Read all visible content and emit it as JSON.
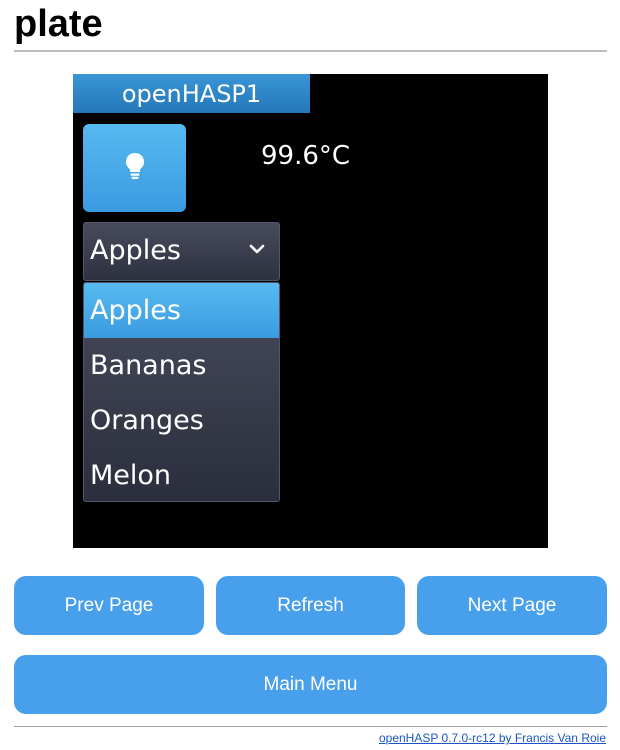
{
  "page": {
    "title": "plate"
  },
  "screen": {
    "title": "openHASP1",
    "temperature": "99.6°C",
    "light_button_icon": "lightbulb-icon",
    "dropdown": {
      "selected": "Apples",
      "options": [
        "Apples",
        "Bananas",
        "Oranges",
        "Melon"
      ]
    }
  },
  "nav": {
    "prev_label": "Prev Page",
    "refresh_label": "Refresh",
    "next_label": "Next Page",
    "main_label": "Main Menu"
  },
  "footer": {
    "link_text": "openHASP 0.7.0-rc12 by Francis Van Roie"
  },
  "colors": {
    "button_blue": "#48a0ec",
    "screen_title_blue": "#2f86c8",
    "screen_background": "#000000",
    "widget_dark": "#3a3d4d",
    "link_blue": "#1a56c4"
  }
}
